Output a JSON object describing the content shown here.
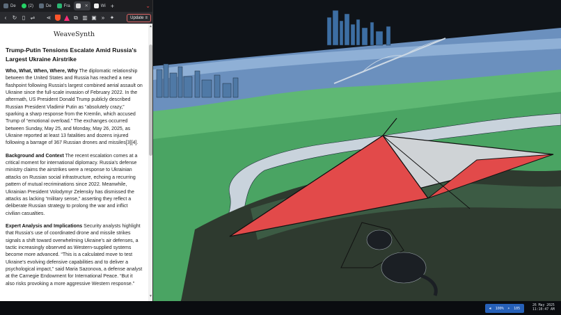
{
  "browser": {
    "tabs": [
      {
        "label": "De",
        "favicon_color": "#5c6b7a",
        "active": false
      },
      {
        "label": "(2)",
        "favicon_color": "#25d366",
        "active": false
      },
      {
        "label": "De",
        "favicon_color": "#5c6b7a",
        "active": false
      },
      {
        "label": "Fra",
        "favicon_color": "#2bb673",
        "active": false
      },
      {
        "label": "",
        "favicon_color": "#dcdcdc",
        "active": true
      },
      {
        "label": "Wi",
        "favicon_color": "#eeeeee",
        "active": false
      }
    ],
    "update_label": "Update"
  },
  "page": {
    "logo": "WeaveSynth",
    "headline": "Trump-Putin Tensions Escalate Amid Russia's Largest Ukraine Airstrike",
    "sections": [
      {
        "heading": "Who, What, When, Where, Why",
        "body": " The diplomatic relationship between the United States and Russia has reached a new flashpoint following Russia's largest combined aerial assault on Ukraine since the full-scale invasion of February 2022. In the aftermath, US President Donald Trump publicly described Russian President Vladimir Putin as “absolutely crazy,” sparking a sharp response from the Kremlin, which accused Trump of “emotional overload.” The exchanges occurred between Sunday, May 25, and Monday, May 26, 2025, as Ukraine reported at least 13 fatalities and dozens injured following a barrage of 367 Russian drones and missiles[3][4]."
      },
      {
        "heading": "Background and Context",
        "body": " The recent escalation comes at a critical moment for international diplomacy. Russia's defense ministry claims the airstrikes were a response to Ukrainian attacks on Russian social infrastructure, echoing a recurring pattern of mutual recriminations since 2022. Meanwhile, Ukrainian President Volodymyr Zelensky has dismissed the attacks as lacking “military sense,” asserting they reflect a deliberate Russian strategy to prolong the war and inflict civilian casualties."
      },
      {
        "heading": "Expert Analysis and Implications",
        "body": " Security analysts highlight that Russia's use of coordinated drone and missile strikes signals a shift toward overwhelming Ukraine's air defenses, a tactic increasingly observed as Western-supplied systems become more advanced. “This is a calculated move to test Ukraine's evolving defensive capabilities and to deliver a psychological impact,” said Maria Sazonova, a defense analyst at the Carnegie Endowment for International Peace. “But it also risks provoking a more aggressive Western response.”"
      }
    ]
  },
  "taskbar": {
    "tray_volume": "100%",
    "tray_brightness": "105",
    "clock_date": "26 May 2025",
    "clock_time": "11:10:47 AM"
  },
  "colors": {
    "wallpaper_water": "#5f86b5",
    "wallpaper_green": "#5fb874",
    "glider_red": "#e24a4a"
  }
}
